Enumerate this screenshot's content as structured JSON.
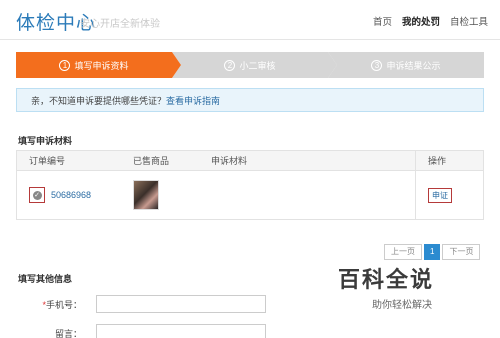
{
  "header": {
    "brand": "体检中心",
    "slogan": "安心开店全新体验",
    "nav": [
      "首页",
      "我的处罚",
      "自检工具"
    ]
  },
  "steps": [
    {
      "num": "1",
      "label": "填写申诉资料"
    },
    {
      "num": "2",
      "label": "小二审核"
    },
    {
      "num": "3",
      "label": "申诉结果公示"
    }
  ],
  "notice": {
    "text": "亲，不知道申诉要提供哪些凭证？",
    "link": "查看申诉指南"
  },
  "materials": {
    "title": "填写申诉材料",
    "columns": [
      "订单编号",
      "已售商品",
      "申诉材料",
      "操作"
    ],
    "row": {
      "order_no": "50686968",
      "action": "申证"
    }
  },
  "pager": {
    "prev": "上一页",
    "current": "1",
    "next": "下一页"
  },
  "other_info": {
    "title": "填写其他信息",
    "phone_label": "手机号：",
    "required_mark": "*",
    "message_label": "留言："
  },
  "watermark": {
    "title": "百科全说",
    "subtitle": "助你轻松解决"
  },
  "colors": {
    "accent_orange": "#f36e1d",
    "link_blue": "#2b6ca3",
    "brand_blue": "#2b7bb9",
    "highlight_red": "#b53a3a"
  }
}
